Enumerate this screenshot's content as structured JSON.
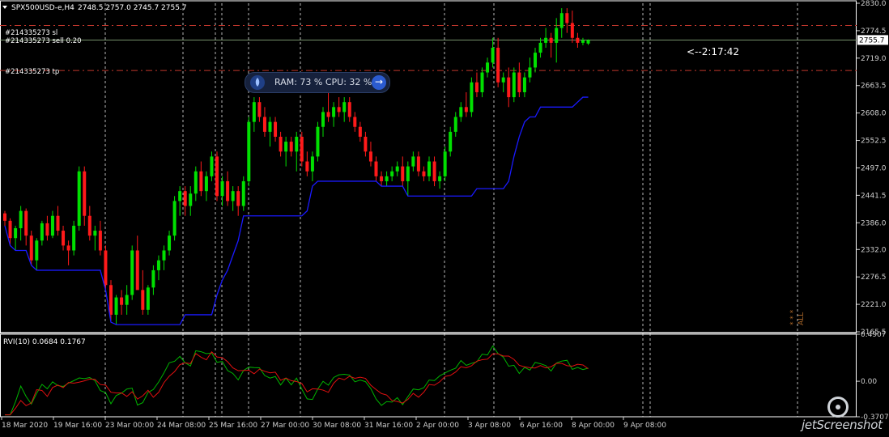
{
  "window": {
    "menu_icon": "triangle-down-icon",
    "symbol_label": "SPX500USD-e,H4",
    "ohlc": "2748.5 2757.0 2745.7 2755.7"
  },
  "orders": {
    "sl_label": "#214335273 sl",
    "sell_label": "#214335273 sell 0.20",
    "tp_label": "#214335273 tp"
  },
  "countdown": "<--2:17:42",
  "price_marker": "2755.7",
  "indicator": {
    "title": "RVI(10) 0.0684 0.1767"
  },
  "overlay": {
    "icon": "rocket-icon",
    "text": "RAM: 73 %  CPU: 32 %",
    "arrow_icon": "arrow-right-icon"
  },
  "all_marker": "ALL",
  "stars": "* * *",
  "logo": {
    "text": "jetScreenshot",
    "icon": "eye-icon"
  },
  "colors": {
    "bull": "#00e000",
    "bear": "#ff1a1a",
    "trend": "#1a1aff",
    "sl_tp_line": "#c0372c",
    "rvi_green": "#00b400",
    "rvi_red": "#e01010",
    "axis": "#cfcfcf",
    "grid": "#e6e6e6"
  },
  "chart_data": {
    "type": "candlestick",
    "price_axis": {
      "min": 2165.5,
      "max": 2830.0,
      "ticks": [
        "2830.0",
        "2774.5",
        "2719.0",
        "2663.5",
        "2608.0",
        "2552.5",
        "2497.0",
        "2441.5",
        "2386.0",
        "2332.0",
        "2276.5",
        "2221.0",
        "2165.5"
      ]
    },
    "rvi_axis": {
      "min": -0.3707,
      "max": 0.4907,
      "ticks": [
        "0.4907",
        "0.00",
        "-0.3707"
      ]
    },
    "levels": {
      "sl": 2785.0,
      "entry": 2755.7,
      "tp": 2694.0
    },
    "x_labels": [
      "18 Mar 2020",
      "19 Mar 16:00",
      "23 Mar 00:00",
      "24 Mar 08:00",
      "25 Mar 16:00",
      "27 Mar 00:00",
      "30 Mar 08:00",
      "31 Mar 16:00",
      "2 Apr 00:00",
      "3 Apr 08:00",
      "6 Apr 16:00",
      "8 Apr 00:00",
      "9 Apr 08:00"
    ],
    "candles": [
      [
        2405,
        2410,
        2380,
        2390
      ],
      [
        2390,
        2395,
        2340,
        2355
      ],
      [
        2355,
        2380,
        2330,
        2375
      ],
      [
        2375,
        2420,
        2350,
        2410
      ],
      [
        2410,
        2415,
        2340,
        2360
      ],
      [
        2360,
        2370,
        2300,
        2310
      ],
      [
        2310,
        2355,
        2290,
        2350
      ],
      [
        2350,
        2390,
        2340,
        2385
      ],
      [
        2385,
        2400,
        2350,
        2360
      ],
      [
        2360,
        2410,
        2355,
        2400
      ],
      [
        2400,
        2420,
        2360,
        2370
      ],
      [
        2370,
        2380,
        2330,
        2340
      ],
      [
        2340,
        2350,
        2300,
        2330
      ],
      [
        2330,
        2390,
        2320,
        2380
      ],
      [
        2380,
        2500,
        2370,
        2490
      ],
      [
        2490,
        2500,
        2380,
        2400
      ],
      [
        2400,
        2420,
        2350,
        2360
      ],
      [
        2360,
        2380,
        2330,
        2370
      ],
      [
        2370,
        2390,
        2320,
        2330
      ],
      [
        2330,
        2340,
        2250,
        2260
      ],
      [
        2260,
        2270,
        2185,
        2200
      ],
      [
        2200,
        2240,
        2180,
        2235
      ],
      [
        2235,
        2250,
        2200,
        2220
      ],
      [
        2220,
        2260,
        2200,
        2240
      ],
      [
        2240,
        2340,
        2230,
        2330
      ],
      [
        2330,
        2360,
        2300,
        2250
      ],
      [
        2250,
        2290,
        2200,
        2210
      ],
      [
        2210,
        2260,
        2200,
        2255
      ],
      [
        2255,
        2300,
        2240,
        2290
      ],
      [
        2290,
        2320,
        2270,
        2310
      ],
      [
        2310,
        2340,
        2290,
        2330
      ],
      [
        2330,
        2370,
        2320,
        2360
      ],
      [
        2360,
        2440,
        2350,
        2430
      ],
      [
        2430,
        2460,
        2400,
        2450
      ],
      [
        2450,
        2460,
        2400,
        2420
      ],
      [
        2420,
        2460,
        2400,
        2445
      ],
      [
        2445,
        2500,
        2430,
        2490
      ],
      [
        2490,
        2510,
        2440,
        2450
      ],
      [
        2450,
        2490,
        2430,
        2480
      ],
      [
        2480,
        2530,
        2470,
        2520
      ],
      [
        2520,
        2530,
        2430,
        2440
      ],
      [
        2440,
        2480,
        2420,
        2470
      ],
      [
        2470,
        2490,
        2420,
        2430
      ],
      [
        2430,
        2460,
        2410,
        2450
      ],
      [
        2450,
        2460,
        2400,
        2420
      ],
      [
        2420,
        2480,
        2410,
        2470
      ],
      [
        2470,
        2600,
        2460,
        2590
      ],
      [
        2590,
        2640,
        2570,
        2630
      ],
      [
        2630,
        2640,
        2590,
        2600
      ],
      [
        2600,
        2620,
        2560,
        2570
      ],
      [
        2570,
        2600,
        2540,
        2590
      ],
      [
        2590,
        2600,
        2550,
        2560
      ],
      [
        2560,
        2570,
        2520,
        2530
      ],
      [
        2530,
        2560,
        2500,
        2550
      ],
      [
        2550,
        2560,
        2520,
        2530
      ],
      [
        2530,
        2570,
        2490,
        2560
      ],
      [
        2560,
        2570,
        2500,
        2510
      ],
      [
        2510,
        2530,
        2480,
        2490
      ],
      [
        2490,
        2530,
        2470,
        2520
      ],
      [
        2520,
        2590,
        2510,
        2580
      ],
      [
        2580,
        2620,
        2560,
        2610
      ],
      [
        2610,
        2650,
        2590,
        2600
      ],
      [
        2600,
        2630,
        2580,
        2620
      ],
      [
        2620,
        2640,
        2600,
        2610
      ],
      [
        2610,
        2640,
        2590,
        2630
      ],
      [
        2630,
        2640,
        2590,
        2600
      ],
      [
        2600,
        2610,
        2570,
        2580
      ],
      [
        2580,
        2590,
        2550,
        2560
      ],
      [
        2560,
        2570,
        2520,
        2530
      ],
      [
        2530,
        2550,
        2500,
        2510
      ],
      [
        2510,
        2520,
        2470,
        2480
      ],
      [
        2480,
        2490,
        2460,
        2470
      ],
      [
        2470,
        2490,
        2460,
        2480
      ],
      [
        2480,
        2500,
        2470,
        2490
      ],
      [
        2490,
        2510,
        2480,
        2500
      ],
      [
        2500,
        2520,
        2460,
        2470
      ],
      [
        2470,
        2510,
        2440,
        2500
      ],
      [
        2500,
        2530,
        2490,
        2520
      ],
      [
        2520,
        2530,
        2480,
        2490
      ],
      [
        2490,
        2500,
        2470,
        2480
      ],
      [
        2480,
        2520,
        2470,
        2510
      ],
      [
        2510,
        2520,
        2460,
        2470
      ],
      [
        2470,
        2490,
        2455,
        2480
      ],
      [
        2480,
        2540,
        2470,
        2530
      ],
      [
        2530,
        2580,
        2520,
        2570
      ],
      [
        2570,
        2610,
        2560,
        2600
      ],
      [
        2600,
        2630,
        2590,
        2620
      ],
      [
        2620,
        2650,
        2600,
        2610
      ],
      [
        2610,
        2680,
        2600,
        2670
      ],
      [
        2670,
        2690,
        2640,
        2650
      ],
      [
        2650,
        2700,
        2640,
        2690
      ],
      [
        2690,
        2720,
        2680,
        2710
      ],
      [
        2710,
        2760,
        2700,
        2740
      ],
      [
        2740,
        2760,
        2660,
        2670
      ],
      [
        2670,
        2690,
        2650,
        2680
      ],
      [
        2680,
        2700,
        2620,
        2640
      ],
      [
        2640,
        2700,
        2630,
        2690
      ],
      [
        2690,
        2710,
        2640,
        2650
      ],
      [
        2650,
        2690,
        2640,
        2680
      ],
      [
        2680,
        2720,
        2670,
        2700
      ],
      [
        2700,
        2740,
        2690,
        2730
      ],
      [
        2730,
        2760,
        2720,
        2750
      ],
      [
        2750,
        2780,
        2740,
        2760
      ],
      [
        2760,
        2770,
        2720,
        2750
      ],
      [
        2750,
        2800,
        2710,
        2780
      ],
      [
        2780,
        2820,
        2760,
        2810
      ],
      [
        2810,
        2820,
        2770,
        2790
      ],
      [
        2790,
        2815,
        2750,
        2760
      ],
      [
        2760,
        2770,
        2740,
        2750
      ],
      [
        2750,
        2760,
        2745,
        2755
      ],
      [
        2748.5,
        2757.0,
        2745.7,
        2755.7
      ]
    ]
  }
}
